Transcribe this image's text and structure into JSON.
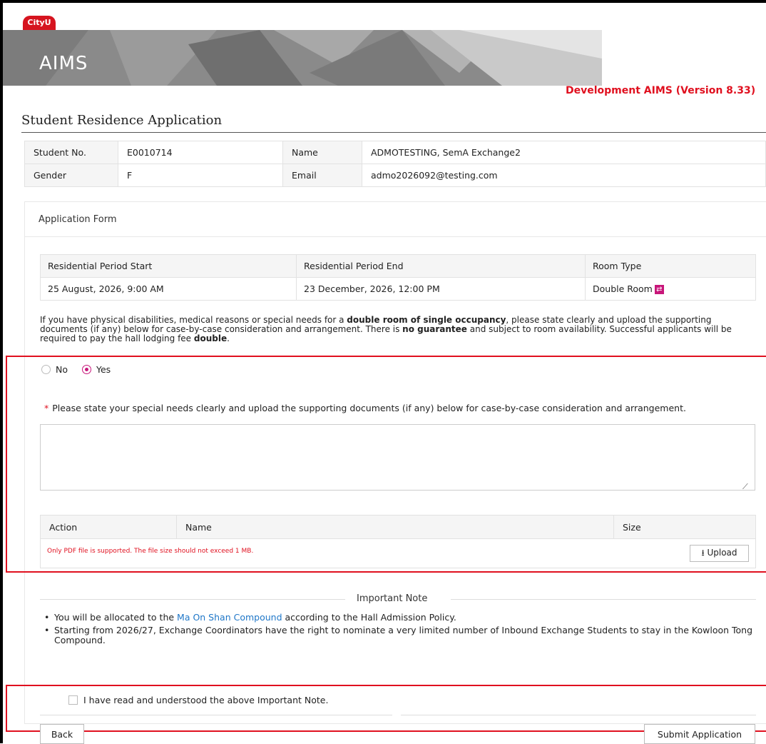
{
  "header": {
    "logo_text": "CityU",
    "app_title": "AIMS",
    "version": "Development AIMS (Version 8.33)"
  },
  "page_title": "Student Residence Application",
  "student": {
    "student_no_label": "Student No.",
    "student_no": "E0010714",
    "name_label": "Name",
    "name": "ADMOTESTING, SemA Exchange2",
    "gender_label": "Gender",
    "gender": "F",
    "email_label": "Email",
    "email": "admo2026092@testing.com"
  },
  "form": {
    "heading": "Application Form",
    "period": {
      "start_label": "Residential Period Start",
      "end_label": "Residential Period End",
      "room_label": "Room Type",
      "start": "25 August, 2026, 9:00 AM",
      "end": "23 December, 2026, 12:00 PM",
      "room_type": "Double Room"
    },
    "notice": {
      "p1": "If you have physical disabilities, medical reasons or special needs for a ",
      "b1": "double room of single occupancy",
      "p2": ", please state clearly and upload the supporting documents (if any) below for case-by-case consideration and arrangement. There is ",
      "b2": "no guarantee",
      "p3": " and subject to room availability. Successful applicants will be required to pay the hall lodging fee ",
      "b3": "double",
      "p4": "."
    },
    "radio_no": "No",
    "radio_yes": "Yes",
    "required_star": "*",
    "special_needs_prompt": "Please state your special needs clearly and upload the supporting documents (if any) below for case-by-case consideration and arrangement.",
    "special_needs_value": "",
    "upload": {
      "col_action": "Action",
      "col_name": "Name",
      "col_size": "Size",
      "hint": "Only PDF file is supported. The file size should not exceed 1 MB.",
      "button": "⭳ Upload"
    }
  },
  "important": {
    "title": "Important Note",
    "item1_pre": "You will be allocated to the ",
    "item1_link": "Ma On Shan Compound",
    "item1_post": " according to the Hall Admission Policy.",
    "item2": "Starting from 2026/27, Exchange Coordinators have the right to nominate a very limited number of Inbound Exchange Students to stay in the Kowloon Tong Compound.",
    "ack": "I have read and understood the above Important Note."
  },
  "actions": {
    "back": "Back",
    "submit": "Submit Application"
  },
  "colors": {
    "brand_red": "#e0101f",
    "accent_magenta": "#c8167a",
    "banner_gray": "#8a8a8a",
    "link_blue": "#1f77c8"
  }
}
